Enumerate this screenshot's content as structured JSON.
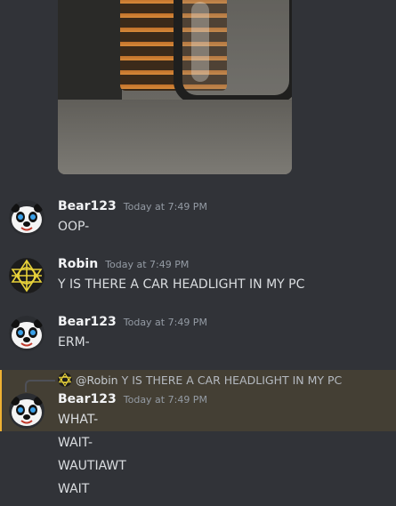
{
  "colors": {
    "background": "#313338",
    "highlight": "#443f34",
    "highlight_border": "#f0b232",
    "username": "#f2f3f5",
    "timestamp": "#949ba4",
    "text": "#dbdee1"
  },
  "attachment": {
    "icon": "image-attachment"
  },
  "messages": [
    {
      "username": "Bear123",
      "timestamp": "Today at 7:49 PM",
      "avatar_icon": "panda-avatar",
      "lines": [
        "OOP-"
      ]
    },
    {
      "username": "Robin",
      "timestamp": "Today at 7:49 PM",
      "avatar_icon": "yellow-pattern-avatar",
      "lines": [
        "Y IS THERE A CAR HEADLIGHT IN MY PC"
      ]
    },
    {
      "username": "Bear123",
      "timestamp": "Today at 7:49 PM",
      "avatar_icon": "panda-avatar",
      "lines": [
        "ERM-"
      ]
    },
    {
      "username": "Bear123",
      "timestamp": "Today at 7:49 PM",
      "avatar_icon": "panda-avatar",
      "reply": {
        "mention": "@Robin",
        "text": "Y IS THERE A CAR HEADLIGHT IN MY PC"
      },
      "lines": [
        "WHAT-",
        "WAIT-",
        "WAUTIAWT",
        "WAIT"
      ]
    }
  ]
}
